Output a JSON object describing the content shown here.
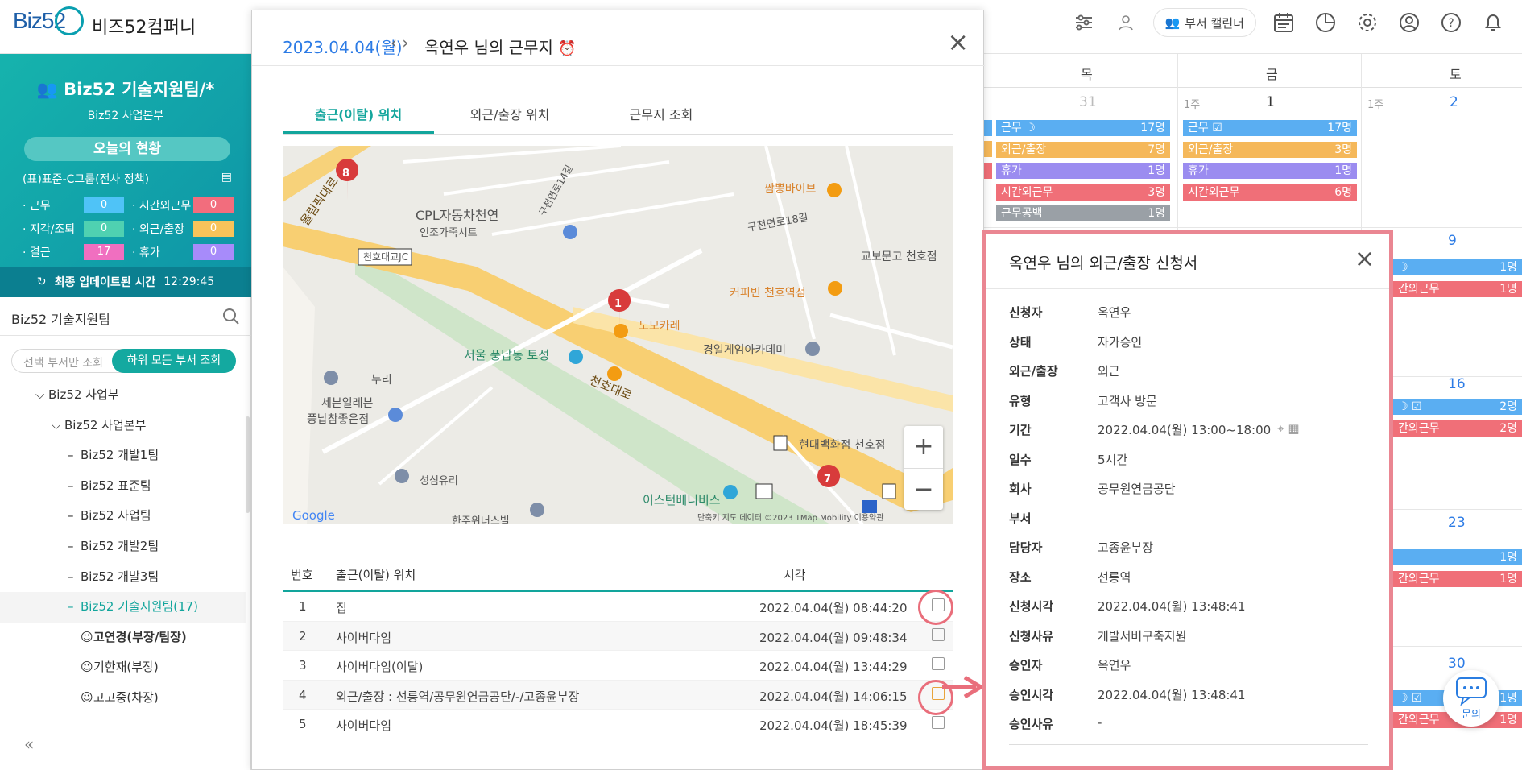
{
  "app": {
    "logo": "Biz52",
    "company": "비즈52컴퍼니",
    "dept_calendar": "부서 캘린더"
  },
  "team": {
    "name": "Biz52 기술지원팀/*",
    "division": "Biz52 사업본부",
    "today": "오늘의 현황",
    "policy": "(표)표준-C그룹(전사 정책)",
    "stats": [
      {
        "label": "· 근무",
        "value": "0",
        "color": "#4fc3f7"
      },
      {
        "label": "· 시간외근무",
        "value": "0",
        "color": "#f26d7d"
      },
      {
        "label": "· 지각/조퇴",
        "value": "0",
        "color": "#4fd1b1"
      },
      {
        "label": "· 외근/출장",
        "value": "0",
        "color": "#f8c35a"
      },
      {
        "label": "· 결근",
        "value": "17",
        "color": "#f06fc0"
      },
      {
        "label": "· 휴가",
        "value": "0",
        "color": "#a78bfa"
      }
    ],
    "update_label": "최종 업데이트된 시간",
    "update_time": "12:29:45"
  },
  "search": {
    "value": "Biz52 기술지원팀"
  },
  "toggle": {
    "off": "선택 부서만 조회",
    "on": "하위 모든 부서 조회"
  },
  "tree": [
    {
      "label": "Biz52 사업부",
      "prefix": "⌵",
      "indent": 44
    },
    {
      "label": "Biz52 사업본부",
      "prefix": "⌵",
      "indent": 64
    },
    {
      "label": "Biz52 개발1팀",
      "prefix": "–",
      "indent": 84
    },
    {
      "label": "Biz52 표준팀",
      "prefix": "–",
      "indent": 84
    },
    {
      "label": "Biz52 사업팀",
      "prefix": "–",
      "indent": 84
    },
    {
      "label": "Biz52 개발2팀",
      "prefix": "–",
      "indent": 84
    },
    {
      "label": "Biz52 개발3팀",
      "prefix": "–",
      "indent": 84
    },
    {
      "label": "Biz52 기술지원팀(17)",
      "prefix": "–",
      "indent": 84,
      "selected": true
    },
    {
      "label": "고연경(부장/팀장)",
      "prefix": "☺",
      "indent": 100,
      "bold": true
    },
    {
      "label": "기한재(부장)",
      "prefix": "☺",
      "indent": 100
    },
    {
      "label": "고고중(차장)",
      "prefix": "☺",
      "indent": 100
    }
  ],
  "calendar": {
    "days": [
      "목",
      "금",
      "토"
    ],
    "week1": {
      "thu": "31",
      "fri": "1",
      "sat": "2",
      "wk": "1주"
    },
    "thu_bars": [
      {
        "label": "근무 ☽",
        "count": "17명",
        "color": "#5aaef2"
      },
      {
        "label": "외근/출장",
        "count": "7명",
        "color": "#f5b85a"
      },
      {
        "label": "휴가",
        "count": "1명",
        "color": "#9b8cf0"
      },
      {
        "label": "시간외근무",
        "count": "3명",
        "color": "#f06f78"
      },
      {
        "label": "근무공백",
        "count": "1명",
        "color": "#9aa0a6"
      }
    ],
    "fri_bars": [
      {
        "label": "근무 ☑",
        "count": "17명",
        "color": "#5aaef2"
      },
      {
        "label": "외근/출장",
        "count": "3명",
        "color": "#f5b85a"
      },
      {
        "label": "휴가",
        "count": "1명",
        "color": "#9b8cf0"
      },
      {
        "label": "시간외근무",
        "count": "6명",
        "color": "#f06f78"
      }
    ],
    "sat_nums": [
      "9",
      "16",
      "23",
      "30"
    ],
    "sat_bars": [
      {
        "label": "☽",
        "count": "1명",
        "color": "#5aaef2"
      },
      {
        "label": "간외근무",
        "count": "1명",
        "color": "#f06f78"
      },
      {
        "label": "☽ ☑",
        "count": "2명",
        "color": "#5aaef2"
      },
      {
        "label": "간외근무",
        "count": "2명",
        "color": "#f06f78"
      },
      {
        "label": "",
        "count": "1명",
        "color": "#5aaef2"
      },
      {
        "label": "간외근무",
        "count": "1명",
        "color": "#f06f78"
      },
      {
        "label": "☽ ☑",
        "count": "1명",
        "color": "#5aaef2"
      },
      {
        "label": "간외근무",
        "count": "1명",
        "color": "#f06f78"
      }
    ]
  },
  "modal": {
    "date": "2023.04.04(월)",
    "title": "옥연우 님의 근무지",
    "tabs": [
      "출근(이탈) 위치",
      "외근/출장 위치",
      "근무지 조회"
    ],
    "map": {
      "labels": [
        "올림픽대로",
        "CPL자동차천연",
        "인조가죽시트",
        "천호대교JC",
        "구천면로14길",
        "짬뽕바이브",
        "구천면로18길",
        "교보문고 천호점",
        "커피빈 천호역점",
        "도모카레",
        "경일게임아카데미",
        "서울 풍납동 토성",
        "천호대로",
        "누리",
        "세븐일레븐",
        "풍납참좋은점",
        "성심유리",
        "현대백화점 천호점",
        "이스턴베니비스",
        "한주위너스빌",
        "Google",
        "단축키  지도 데이터 ©2023 TMap Mobility  이용약관"
      ]
    },
    "headers": [
      "번호",
      "출근(이탈) 위치",
      "시각"
    ],
    "rows": [
      {
        "no": "1",
        "loc": "집",
        "time": "2022.04.04(월) 08:44:20"
      },
      {
        "no": "2",
        "loc": "사이버다임",
        "time": "2022.04.04(월) 09:48:34"
      },
      {
        "no": "3",
        "loc": "사이버다임(이탈)",
        "time": "2022.04.04(월) 13:44:29"
      },
      {
        "no": "4",
        "loc": "외근/출장 : 선릉역/공무원연금공단/-/고종윤부장",
        "time": "2022.04.04(월) 14:06:15"
      },
      {
        "no": "5",
        "loc": "사이버다임",
        "time": "2022.04.04(월) 18:45:39"
      }
    ]
  },
  "detail": {
    "title": "옥연우 님의 외근/출장 신청서",
    "fields": [
      {
        "k": "신청자",
        "v": "옥연우"
      },
      {
        "k": "상태",
        "v": "자가승인"
      },
      {
        "k": "외근/출장",
        "v": "외근"
      },
      {
        "k": "유형",
        "v": "고객사 방문"
      },
      {
        "k": "기간",
        "v": "2022.04.04(월) 13:00~18:00"
      },
      {
        "k": "일수",
        "v": "5시간"
      },
      {
        "k": "회사",
        "v": "공무원연금공단"
      },
      {
        "k": "부서",
        "v": ""
      },
      {
        "k": "담당자",
        "v": "고종윤부장"
      },
      {
        "k": "장소",
        "v": "선릉역"
      },
      {
        "k": "신청시각",
        "v": "2022.04.04(월) 13:48:41"
      },
      {
        "k": "신청사유",
        "v": "개발서버구축지원"
      },
      {
        "k": "승인자",
        "v": "옥연우"
      },
      {
        "k": "승인시각",
        "v": "2022.04.04(월) 13:48:41"
      },
      {
        "k": "승인사유",
        "v": "-"
      }
    ]
  },
  "chat": {
    "label": "문의"
  }
}
